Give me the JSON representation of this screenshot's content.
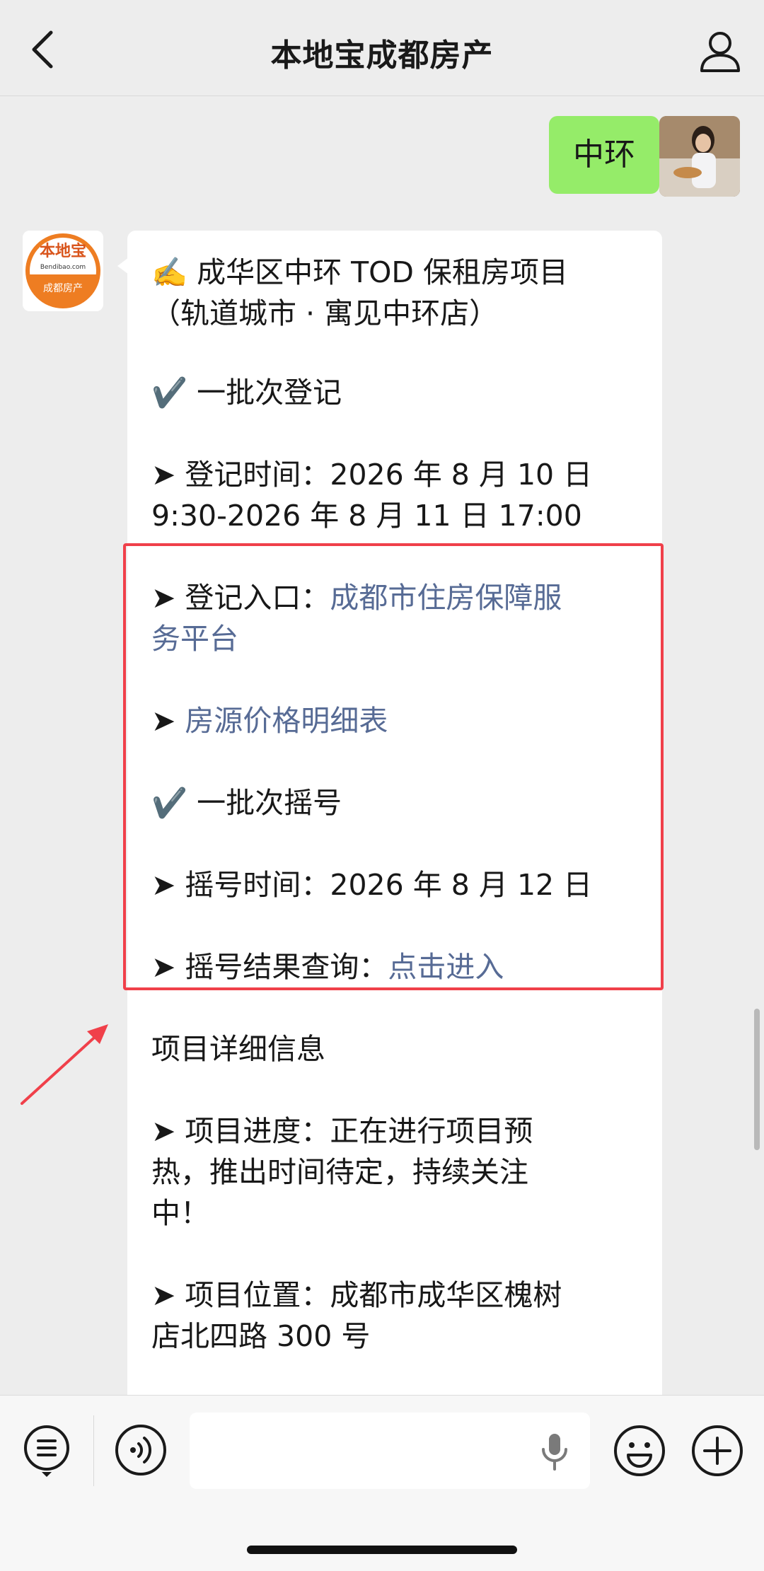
{
  "header": {
    "title": "本地宝成都房产",
    "back_icon": "chevron-left-icon",
    "profile_icon": "person-icon"
  },
  "my_message": {
    "text": "中环"
  },
  "bot": {
    "avatar_text_top": "本地宝",
    "avatar_text_mid": "Bendibao.com",
    "avatar_text_bottom": "成都房产",
    "avatar_color": "#ee7d22"
  },
  "message": {
    "line1": "✍️ 成华区中环 TOD 保租房项目",
    "line2": "（轨道城市 · 寓见中环店）",
    "batch1_register": "✔️ 一批次登记",
    "register_time_label": "➤ 登记时间：",
    "register_time_a": "2026 年 8 月 10 日",
    "register_time_b": "9:30-2026 年 8 月 11 日 17:00",
    "register_entry_label": "➤ 登记入口：",
    "register_entry_link_a": "成都市住房保障服",
    "register_entry_link_b": "务平台",
    "price_prefix": "➤ ",
    "price_link": "房源价格明细表",
    "batch1_lottery": "✔️ 一批次摇号",
    "lottery_time_label": "➤ 摇号时间：",
    "lottery_time": "2026 年 8 月 12 日",
    "lottery_result_label": "➤ 摇号结果查询：",
    "lottery_result_link": "点击进入",
    "project_detail_title": "项目详细信息",
    "progress_a": "➤ 项目进度：正在进行项目预",
    "progress_b": "热，推出时间待定，持续关注",
    "progress_c": "中！",
    "location_a": "➤ 项目位置：成都市成华区槐树",
    "location_b": "店北四路 300 号"
  },
  "colors": {
    "link": "#576b95",
    "highlight": "#f0404a",
    "my_bubble": "#95ec69"
  },
  "bottom_bar": {
    "menu_icon": "list-menu-icon",
    "voice_icon": "voice-icon",
    "mic_icon": "microphone-icon",
    "emoji_icon": "emoji-icon",
    "plus_icon": "plus-circle-icon"
  }
}
